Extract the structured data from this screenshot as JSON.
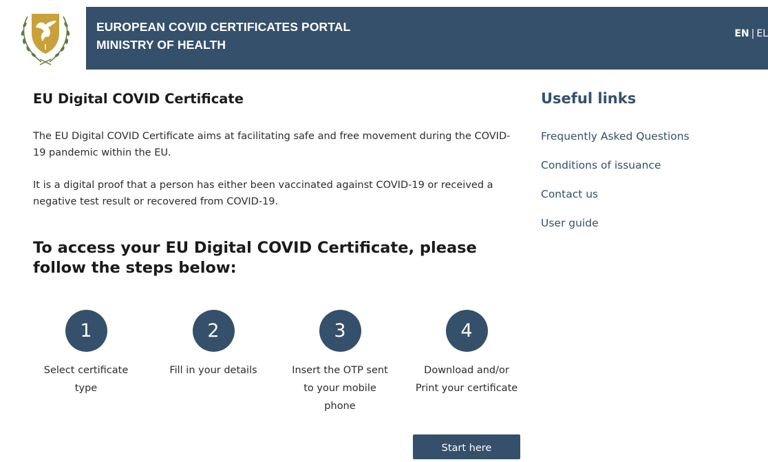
{
  "header": {
    "title_line1": "EUROPEAN COVID CERTIFICATES PORTAL",
    "title_line2": "MINISTRY OF HEALTH",
    "lang_en": "EN",
    "lang_sep": "|",
    "lang_el": "EL",
    "logo_icon": "cyprus-coat-of-arms-icon"
  },
  "main": {
    "title": "EU Digital COVID Certificate",
    "paragraph1": "The EU Digital COVID Certificate aims at facilitating safe and free movement during the COVID-19 pandemic within the EU.",
    "paragraph2": "It is a digital proof that a person has either been vaccinated against COVID-19 or received a negative test result or recovered from COVID-19.",
    "steps_title": "To access your EU Digital COVID Certificate, please follow the steps below:",
    "steps": [
      {
        "number": "1",
        "label": "Select certificate type"
      },
      {
        "number": "2",
        "label": "Fill in your details"
      },
      {
        "number": "3",
        "label": "Insert the OTP sent to your mobile phone"
      },
      {
        "number": "4",
        "label": "Download and/or Print your certificate"
      }
    ],
    "start_button": "Start here"
  },
  "useful_links": {
    "title": "Useful links",
    "items": [
      {
        "label": "Frequently Asked Questions"
      },
      {
        "label": "Conditions of issuance"
      },
      {
        "label": "Contact us"
      },
      {
        "label": "User guide"
      }
    ]
  },
  "colors": {
    "brand": "#35506a",
    "logo_gold": "#c9a13b",
    "logo_olive": "#5d7a3a"
  }
}
